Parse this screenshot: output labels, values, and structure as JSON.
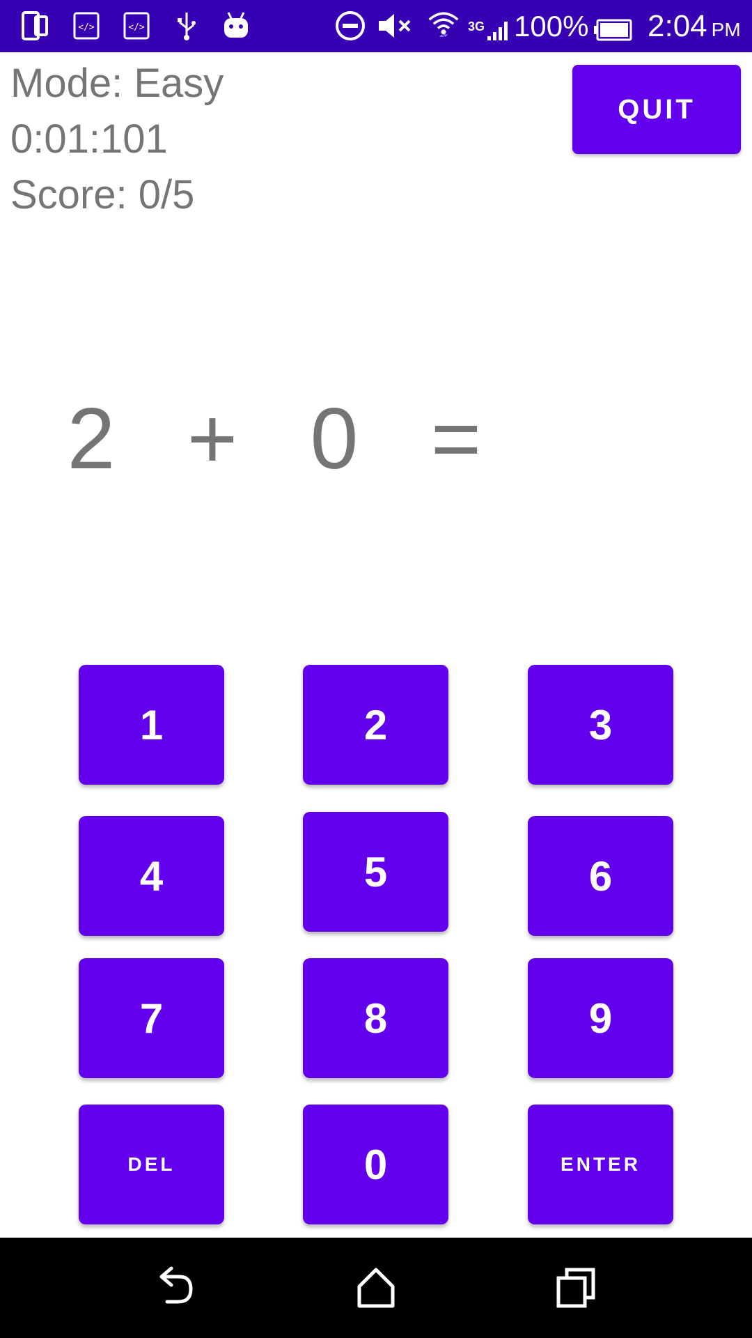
{
  "status_bar": {
    "battery_text": "100%",
    "time": "2:04",
    "ampm": "PM",
    "network_label": "3G",
    "icons": [
      "device-icon",
      "code-icon",
      "code-icon",
      "usb-icon",
      "android-icon",
      "do-not-disturb-icon",
      "mute-icon",
      "wifi-icon",
      "signal-icon",
      "battery-icon"
    ],
    "background_color": "#3700B3"
  },
  "header": {
    "mode": "Mode: Easy",
    "timer": "0:01:101",
    "score": "Score: 0/5",
    "quit_label": "QUIT"
  },
  "equation": {
    "operand1": "2",
    "operator": "+",
    "operand2": "0",
    "equals": "=",
    "answer": ""
  },
  "keypad": {
    "keys": [
      "1",
      "2",
      "3",
      "4",
      "5",
      "6",
      "7",
      "8",
      "9",
      "DEL",
      "0",
      "ENTER"
    ]
  },
  "navigation": {
    "icons": [
      "back-icon",
      "home-icon",
      "recents-icon"
    ]
  },
  "colors": {
    "accent": "#6200EE",
    "status_bar": "#3700B3",
    "text_secondary": "#757575"
  }
}
